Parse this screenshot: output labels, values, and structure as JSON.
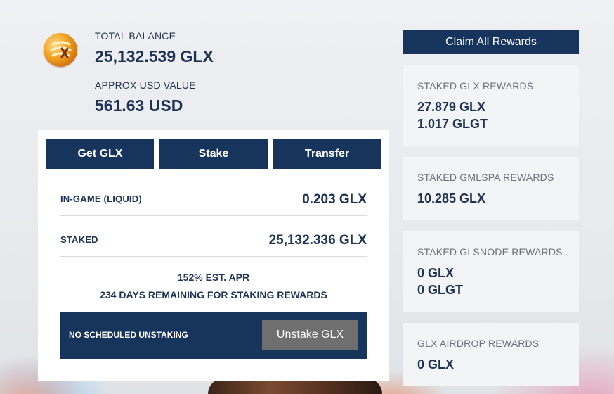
{
  "balance": {
    "total_label": "TOTAL BALANCE",
    "total_value": "25,132.539 GLX",
    "usd_label": "APPROX USD VALUE",
    "usd_value": "561.63 USD"
  },
  "actions": {
    "get_label": "Get GLX",
    "stake_label": "Stake",
    "transfer_label": "Transfer"
  },
  "holdings": [
    {
      "label": "IN-GAME (LIQUID)",
      "value": "0.203 GLX"
    },
    {
      "label": "STAKED",
      "value": "25,132.336 GLX"
    }
  ],
  "staking": {
    "apr_text": "152% EST. APR",
    "days_text": "234 DAYS REMAINING FOR STAKING REWARDS",
    "unstake_status": "NO SCHEDULED UNSTAKING",
    "unstake_button": "Unstake GLX"
  },
  "rewards": {
    "claim_label": "Claim All Rewards",
    "cards": [
      {
        "title": "STAKED GLX REWARDS",
        "lines": [
          "27.879 GLX",
          "1.017 GLGT"
        ]
      },
      {
        "title": "STAKED GMLSPA REWARDS",
        "lines": [
          "10.285 GLX"
        ]
      },
      {
        "title": "STAKED GLSNODE REWARDS",
        "lines": [
          "0 GLX",
          "0 GLGT"
        ]
      },
      {
        "title": "GLX AIRDROP REWARDS",
        "lines": [
          "0 GLX"
        ]
      }
    ]
  },
  "colors": {
    "navy": "#17345c",
    "text_dark": "#1d3254",
    "muted_button": "#6f6f6f",
    "card_bg": "#f3f4f6"
  },
  "icons": {
    "logo": "glx-coin-logo"
  }
}
